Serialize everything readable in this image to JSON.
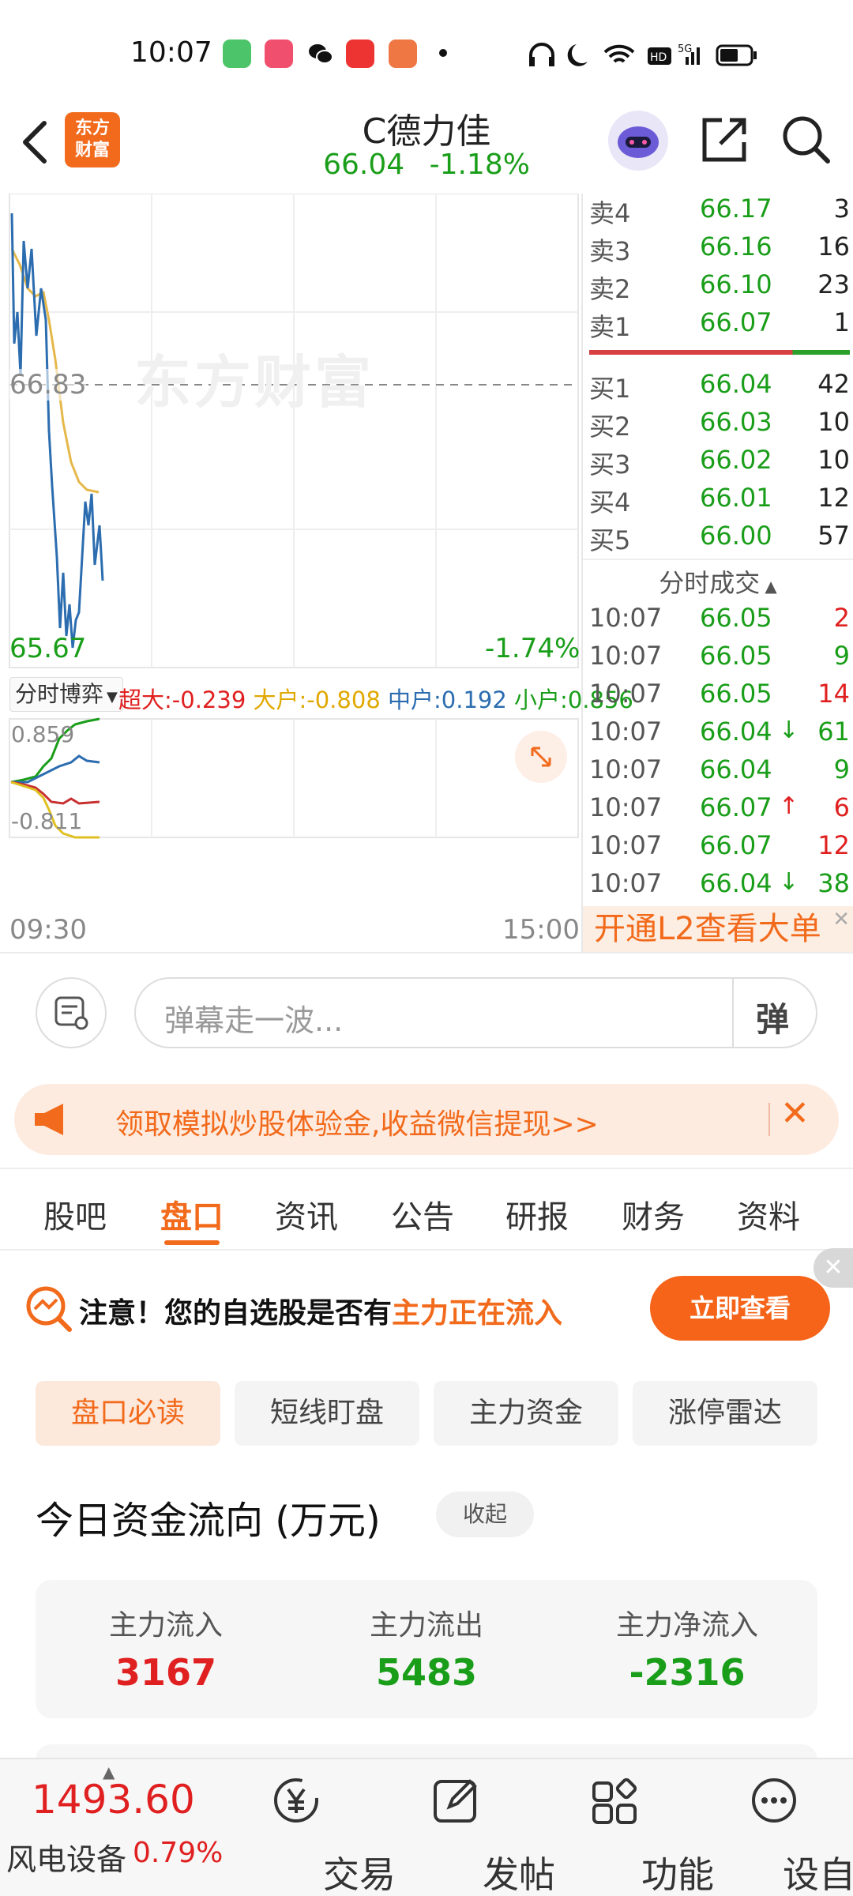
{
  "status_bar": {
    "time": "10:07"
  },
  "header": {
    "logo": [
      "东方",
      "财富"
    ],
    "stock_name": "C德力佳",
    "price": "66.04",
    "change_pct": "-1.18%"
  },
  "chart": {
    "ref_price": "66.83",
    "low_price": "65.67",
    "low_pct": "-1.74%",
    "watermark": "东方财富",
    "indicator_select": "分时博弈",
    "legend": [
      {
        "label": "超大:",
        "value": "-0.239",
        "color": "#e02020"
      },
      {
        "label": "大户:",
        "value": "-0.808",
        "color": "#e0a800"
      },
      {
        "label": "中户:",
        "value": "0.192",
        "color": "#2c6db0"
      },
      {
        "label": "小户:",
        "value": "0.856",
        "color": "#1a9e1a"
      }
    ],
    "sub_max": "0.859",
    "sub_min": "-0.811",
    "time_start": "09:30",
    "time_end": "15:00"
  },
  "order_book": {
    "asks": [
      {
        "label": "卖4",
        "price": "66.17",
        "vol": "3"
      },
      {
        "label": "卖3",
        "price": "66.16",
        "vol": "16"
      },
      {
        "label": "卖2",
        "price": "66.10",
        "vol": "23"
      },
      {
        "label": "卖1",
        "price": "66.07",
        "vol": "1"
      }
    ],
    "bids": [
      {
        "label": "买1",
        "price": "66.04",
        "vol": "42"
      },
      {
        "label": "买2",
        "price": "66.03",
        "vol": "10"
      },
      {
        "label": "买3",
        "price": "66.02",
        "vol": "10"
      },
      {
        "label": "买4",
        "price": "66.01",
        "vol": "12"
      },
      {
        "label": "买5",
        "price": "66.00",
        "vol": "57"
      }
    ],
    "trades_title": "分时成交",
    "trades": [
      {
        "time": "10:07",
        "price": "66.05",
        "arrow": "",
        "vol": "2",
        "vol_color": "#e02020"
      },
      {
        "time": "10:07",
        "price": "66.05",
        "arrow": "",
        "vol": "9",
        "vol_color": "#1a9e1a"
      },
      {
        "time": "10:07",
        "price": "66.05",
        "arrow": "",
        "vol": "14",
        "vol_color": "#e02020"
      },
      {
        "time": "10:07",
        "price": "66.04",
        "arrow": "↓",
        "vol": "61",
        "vol_color": "#1a9e1a"
      },
      {
        "time": "10:07",
        "price": "66.04",
        "arrow": "",
        "vol": "9",
        "vol_color": "#1a9e1a"
      },
      {
        "time": "10:07",
        "price": "66.07",
        "arrow": "↑",
        "vol": "6",
        "vol_color": "#e02020"
      },
      {
        "time": "10:07",
        "price": "66.07",
        "arrow": "",
        "vol": "12",
        "vol_color": "#e02020"
      },
      {
        "time": "10:07",
        "price": "66.04",
        "arrow": "↓",
        "vol": "38",
        "vol_color": "#1a9e1a"
      }
    ],
    "l2_banner": "开通L2查看大单"
  },
  "danmaku": {
    "placeholder": "弹幕走一波...",
    "toggle": "弹"
  },
  "promo": {
    "text": "领取模拟炒股体验金,收益微信提现>>"
  },
  "tabs": [
    {
      "label": "股吧",
      "active": false
    },
    {
      "label": "盘口",
      "active": true
    },
    {
      "label": "资讯",
      "active": false
    },
    {
      "label": "公告",
      "active": false
    },
    {
      "label": "研报",
      "active": false
    },
    {
      "label": "财务",
      "active": false
    },
    {
      "label": "资料",
      "active": false
    }
  ],
  "notice": {
    "prefix": "注意！您的自选股是否有",
    "highlight": "主力正在流入",
    "button": "立即查看"
  },
  "subtabs": [
    "盘口必读",
    "短线盯盘",
    "主力资金",
    "涨停雷达"
  ],
  "flow": {
    "title": "今日资金流向 (万元)",
    "collapse": "收起",
    "items": [
      {
        "label": "主力流入",
        "value": "3167",
        "color": "#e02020"
      },
      {
        "label": "主力流出",
        "value": "5483",
        "color": "#1a9e1a"
      },
      {
        "label": "主力净流入",
        "value": "-2316",
        "color": "#1a9e1a"
      }
    ]
  },
  "bottom_bar": {
    "index_value": "1493.60",
    "index_name": "风电设备",
    "index_pct": "0.79%",
    "items": [
      {
        "label": "交易",
        "icon": "yuan-icon"
      },
      {
        "label": "发帖",
        "icon": "edit-icon"
      },
      {
        "label": "功能",
        "icon": "grid-icon"
      },
      {
        "label": "设自选",
        "icon": "more-icon"
      }
    ]
  },
  "colors": {
    "brand": "#f26a1b",
    "up": "#e02020",
    "down": "#1a9e1a"
  }
}
